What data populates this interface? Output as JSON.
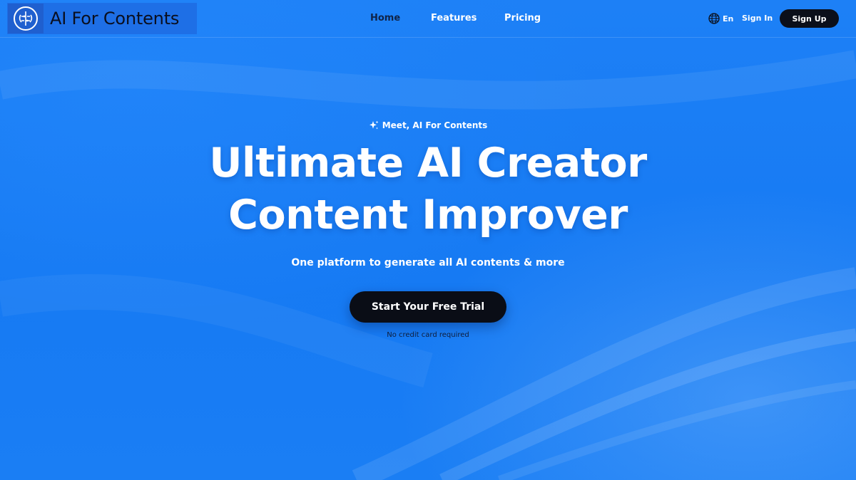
{
  "brand": {
    "name": "AI For Contents",
    "logo_icon": "brain-circuit-icon"
  },
  "nav": {
    "links": [
      {
        "label": "Home",
        "active": true
      },
      {
        "label": "Features",
        "active": false
      },
      {
        "label": "Pricing",
        "active": false
      }
    ],
    "language": {
      "icon": "globe-icon",
      "label": "En"
    },
    "sign_in": "Sign In",
    "sign_up": "Sign Up"
  },
  "hero": {
    "eyebrow_icon": "sparkle-icon",
    "eyebrow": "Meet, AI For Contents",
    "headline_line1": "Ultimate AI Creator",
    "headline_line2": "Content Improver",
    "subheadline": "One platform to generate all AI contents & more",
    "cta_label": "Start Your Free Trial",
    "cta_note": "No credit card required"
  },
  "colors": {
    "background": "#1a7cf5",
    "dark_button": "#0b0f1a",
    "active_nav": "#102448"
  }
}
